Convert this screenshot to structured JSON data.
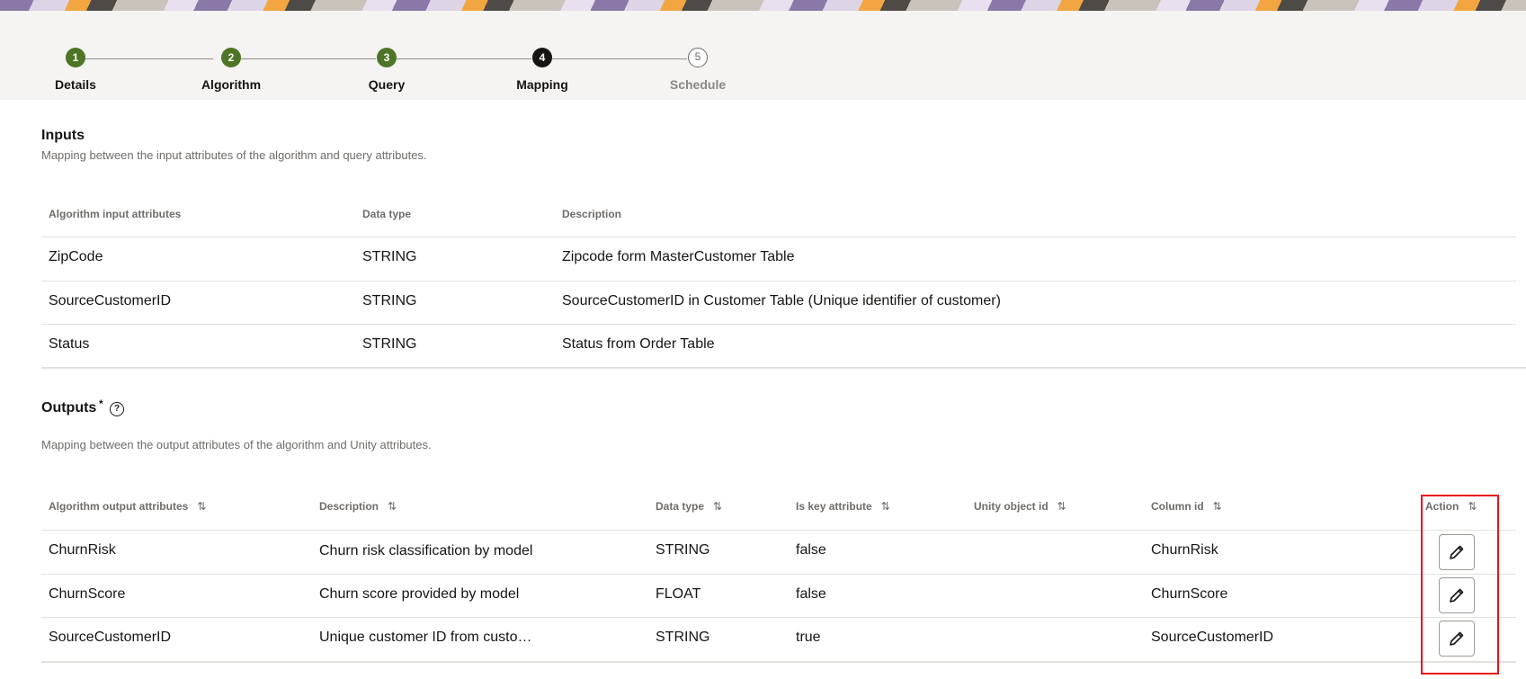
{
  "stepper": {
    "steps": [
      {
        "number": "1",
        "label": "Details",
        "state": "done"
      },
      {
        "number": "2",
        "label": "Algorithm",
        "state": "done"
      },
      {
        "number": "3",
        "label": "Query",
        "state": "done"
      },
      {
        "number": "4",
        "label": "Mapping",
        "state": "current"
      },
      {
        "number": "5",
        "label": "Schedule",
        "state": "todo"
      }
    ]
  },
  "inputs": {
    "title": "Inputs",
    "description": "Mapping between the input attributes of the algorithm and query attributes.",
    "columns": [
      "Algorithm input attributes",
      "Data type",
      "Description"
    ],
    "rows": [
      [
        "ZipCode",
        "STRING",
        "Zipcode form MasterCustomer Table"
      ],
      [
        "SourceCustomerID",
        "STRING",
        "SourceCustomerID in Customer Table (Unique identifier of customer)"
      ],
      [
        "Status",
        "STRING",
        "Status from Order Table"
      ]
    ]
  },
  "outputs": {
    "title": "Outputs",
    "required_marker": "*",
    "help_icon": "question-circle-icon",
    "help_glyph": "?",
    "description": "Mapping between the output attributes of the algorithm and Unity attributes.",
    "columns": [
      "Algorithm output attributes",
      "Description",
      "Data type",
      "Is key attribute",
      "Unity object id",
      "Column id",
      "Action"
    ],
    "sort_icon": "sort-arrows-icon",
    "sort_glyph": "⇅",
    "rows": [
      [
        "ChurnRisk",
        "Churn risk classification by model",
        "STRING",
        "false",
        "",
        "ChurnRisk"
      ],
      [
        "ChurnScore",
        "Churn score provided by model",
        "FLOAT",
        "false",
        "",
        "ChurnScore"
      ],
      [
        "SourceCustomerID",
        "Unique customer ID from custo…",
        "STRING",
        "true",
        "",
        "SourceCustomerID"
      ]
    ],
    "action_icon": "pencil-edit-icon"
  },
  "colors": {
    "step_done": "#4e7426",
    "step_current": "#161513",
    "highlight": "#e8131e"
  }
}
